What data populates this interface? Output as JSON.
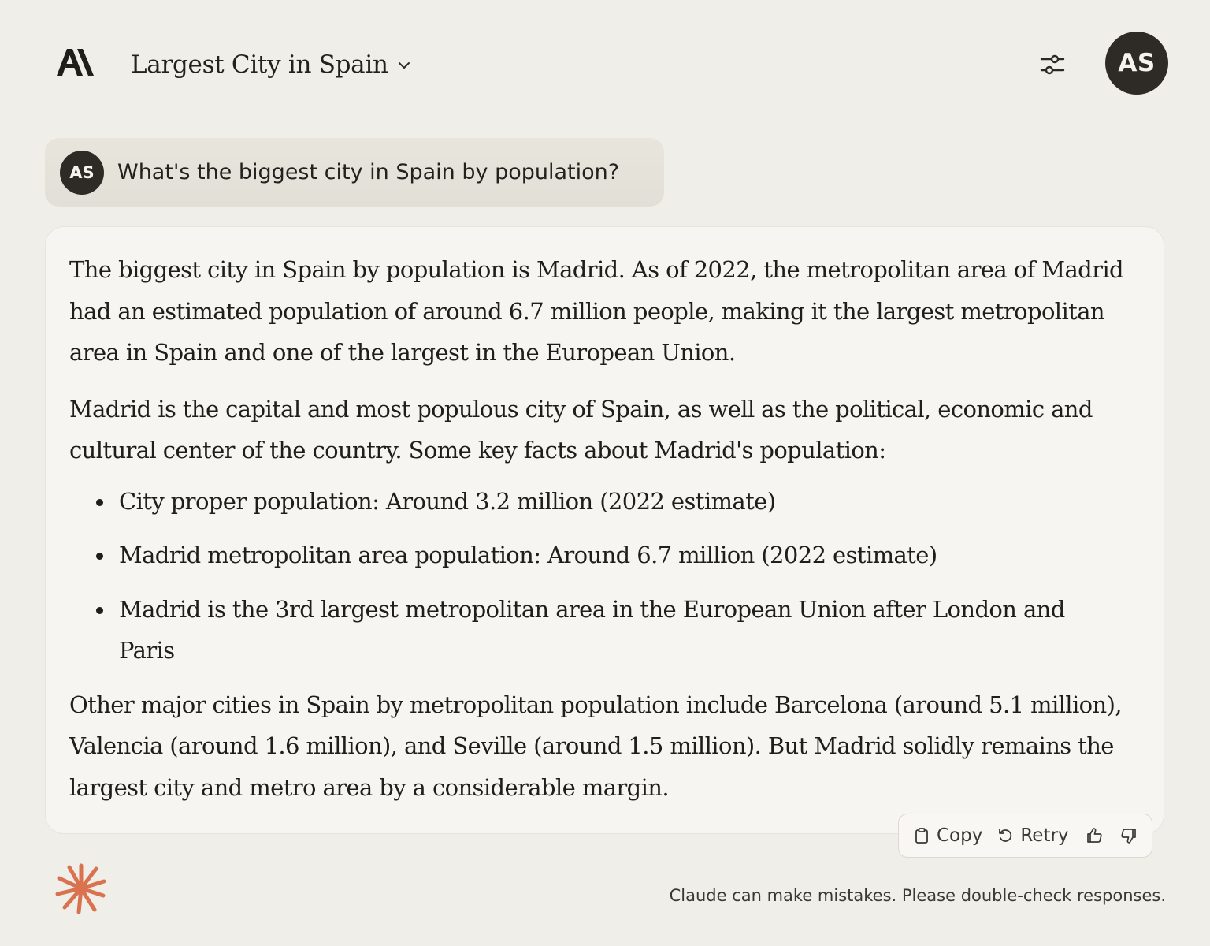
{
  "header": {
    "logo_icon": "anthropic-logo",
    "title": "Largest City in Spain",
    "title_menu_icon": "chevron-down-icon",
    "settings_icon": "sliders-icon",
    "user_initials": "AS"
  },
  "conversation": {
    "user_message": {
      "avatar_initials": "AS",
      "text": "What's the biggest city in Spain by population?"
    },
    "assistant_message": {
      "paragraph_1": "The biggest city in Spain by population is Madrid. As of 2022, the metropolitan area of Madrid had an estimated population of around 6.7 million people, making it the largest metropolitan area in Spain and one of the largest in the European Union.",
      "paragraph_2": "Madrid is the capital and most populous city of Spain, as well as the political, economic and cultural center of the country. Some key facts about Madrid's population:",
      "bullets": [
        "City proper population: Around 3.2 million (2022 estimate)",
        "Madrid metropolitan area population: Around 6.7 million (2022 estimate)",
        "Madrid is the 3rd largest metropolitan area in the European Union after London and Paris"
      ],
      "paragraph_3": "Other major cities in Spain by metropolitan population include Barcelona (around 5.1 million), Valencia (around 1.6 million), and Seville (around 1.5 million). But Madrid solidly remains the largest city and metro area by a considerable margin."
    },
    "actions": {
      "copy_label": "Copy",
      "retry_label": "Retry",
      "copy_icon": "clipboard-icon",
      "retry_icon": "retry-icon",
      "thumbs_up_icon": "thumbs-up-icon",
      "thumbs_down_icon": "thumbs-down-icon"
    }
  },
  "footer": {
    "spark_icon": "claude-spark-icon",
    "disclaimer": "Claude can make mistakes. Please double-check responses."
  },
  "colors": {
    "background": "#f0eee8",
    "user_bubble": "#e5e2da",
    "reply_card": "#f6f5f1",
    "avatar": "#2e2b27",
    "spark": "#d9724f"
  }
}
